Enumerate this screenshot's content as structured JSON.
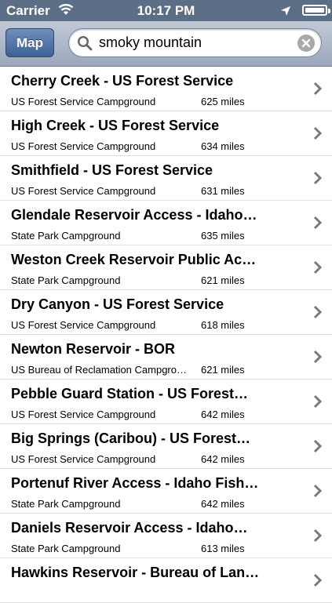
{
  "status": {
    "carrier": "Carrier",
    "time": "10:17 PM"
  },
  "search": {
    "map_label": "Map",
    "query": "smoky mountain"
  },
  "results": [
    {
      "title": "Cherry Creek - US Forest Service",
      "subtitle": "US Forest Service Campground",
      "distance": "625 miles"
    },
    {
      "title": "High Creek - US Forest Service",
      "subtitle": "US Forest Service Campground",
      "distance": "634 miles"
    },
    {
      "title": "Smithfield - US Forest Service",
      "subtitle": "US Forest Service Campground",
      "distance": "631 miles"
    },
    {
      "title": "Glendale Reservoir Access - Idaho…",
      "subtitle": "State Park Campground",
      "distance": "635 miles"
    },
    {
      "title": "Weston Creek Reservoir Public Ac…",
      "subtitle": "State Park Campground",
      "distance": "621 miles"
    },
    {
      "title": "Dry Canyon - US Forest Service",
      "subtitle": "US Forest Service Campground",
      "distance": "618 miles"
    },
    {
      "title": "Newton Reservoir - BOR",
      "subtitle": "US Bureau of Reclamation Campgrou…",
      "distance": "621 miles"
    },
    {
      "title": "Pebble Guard Station - US Forest…",
      "subtitle": "US Forest Service Campground",
      "distance": "642 miles"
    },
    {
      "title": "Big Springs (Caribou) - US Forest…",
      "subtitle": "US Forest Service Campground",
      "distance": "642 miles"
    },
    {
      "title": "Portenuf River Access - Idaho Fish…",
      "subtitle": "State Park Campground",
      "distance": "642 miles"
    },
    {
      "title": "Daniels Reservoir Access - Idaho…",
      "subtitle": "State Park Campground",
      "distance": "613 miles"
    },
    {
      "title": "Hawkins Reservoir - Bureau of Lan…",
      "subtitle": "",
      "distance": ""
    }
  ]
}
